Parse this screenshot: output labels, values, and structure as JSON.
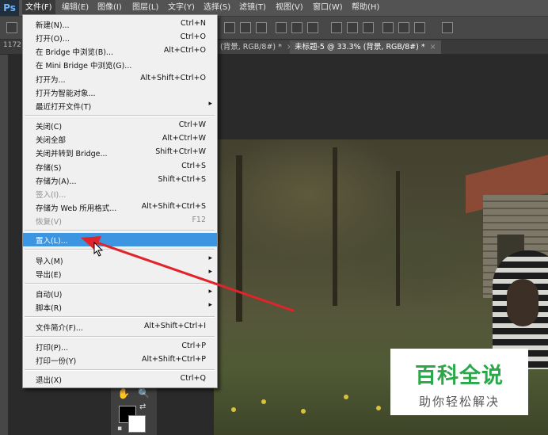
{
  "app": {
    "logo": "Ps"
  },
  "menubar": {
    "items": [
      "文件(F)",
      "编辑(E)",
      "图像(I)",
      "图层(L)",
      "文字(Y)",
      "选择(S)",
      "滤镜(T)",
      "视图(V)",
      "窗口(W)",
      "帮助(H)"
    ]
  },
  "tabs": {
    "left_fragment": "1172",
    "items": [
      {
        "label": "(背景, RGB/8#) *",
        "close": "×"
      },
      {
        "label": "未标题-5 @ 33.3% (背景, RGB/8#) *",
        "close": "×"
      }
    ]
  },
  "file_menu": {
    "items": [
      {
        "label": "新建(N)...",
        "shortcut": "Ctrl+N"
      },
      {
        "label": "打开(O)...",
        "shortcut": "Ctrl+O"
      },
      {
        "label": "在 Bridge 中浏览(B)...",
        "shortcut": "Alt+Ctrl+O"
      },
      {
        "label": "在 Mini Bridge 中浏览(G)...",
        "shortcut": ""
      },
      {
        "label": "打开为...",
        "shortcut": "Alt+Shift+Ctrl+O"
      },
      {
        "label": "打开为智能对象...",
        "shortcut": ""
      },
      {
        "label": "最近打开文件(T)",
        "shortcut": "",
        "submenu": "▸"
      },
      {
        "label": "关闭(C)",
        "shortcut": "Ctrl+W"
      },
      {
        "label": "关闭全部",
        "shortcut": "Alt+Ctrl+W"
      },
      {
        "label": "关闭并转到 Bridge...",
        "shortcut": "Shift+Ctrl+W"
      },
      {
        "label": "存储(S)",
        "shortcut": "Ctrl+S"
      },
      {
        "label": "存储为(A)...",
        "shortcut": "Shift+Ctrl+S"
      },
      {
        "label": "签入(I)...",
        "shortcut": ""
      },
      {
        "label": "存储为 Web 所用格式...",
        "shortcut": "Alt+Shift+Ctrl+S"
      },
      {
        "label": "恢复(V)",
        "shortcut": "F12"
      },
      {
        "label": "置入(L)...",
        "shortcut": ""
      },
      {
        "label": "导入(M)",
        "shortcut": "",
        "submenu": "▸"
      },
      {
        "label": "导出(E)",
        "shortcut": "",
        "submenu": "▸"
      },
      {
        "label": "自动(U)",
        "shortcut": "",
        "submenu": "▸"
      },
      {
        "label": "脚本(R)",
        "shortcut": "",
        "submenu": "▸"
      },
      {
        "label": "文件简介(F)...",
        "shortcut": "Alt+Shift+Ctrl+I"
      },
      {
        "label": "打印(P)...",
        "shortcut": "Ctrl+P"
      },
      {
        "label": "打印一份(Y)",
        "shortcut": "Alt+Shift+Ctrl+P"
      },
      {
        "label": "退出(X)",
        "shortcut": "Ctrl+Q"
      }
    ]
  },
  "watermark": {
    "title": "百科全说",
    "subtitle": "助你轻松解决"
  },
  "colors": {
    "highlight": "#3c95e0",
    "arrow": "#e0242a",
    "watermark_green": "#2aa84a"
  },
  "icons": {
    "hand": "hand-icon",
    "zoom": "zoom-icon",
    "swap": "swap-colors-icon",
    "reset": "default-colors-icon"
  }
}
